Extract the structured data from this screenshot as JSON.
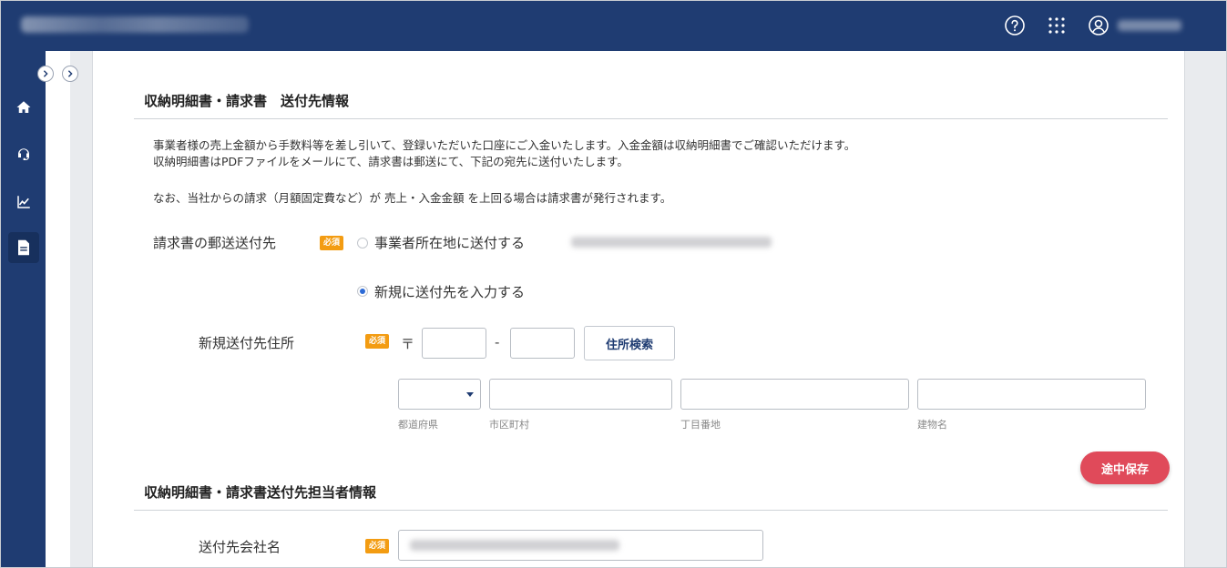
{
  "header": {
    "brand_text": "",
    "user_name": "",
    "icons": [
      "help-icon",
      "apps-grid-icon",
      "user-icon"
    ],
    "bg_color": "#1f3c72"
  },
  "sidebar": {
    "items": [
      {
        "icon": "home-icon"
      },
      {
        "icon": "support-headset-icon"
      },
      {
        "icon": "chart-icon"
      },
      {
        "icon": "document-icon",
        "active": true
      }
    ]
  },
  "section1": {
    "title": "収納明細書・請求書　送付先情報",
    "paragraph_lines": [
      "事業者様の売上金額から手数料等を差し引いて、登録いただいた口座にご入金いたします。入金金額は収納明細書でご確認いただけます。",
      "収納明細書はPDFファイルをメールにて、請求書は郵送にて、下記の宛先に送付いたします。",
      "なお、当社からの請求（月額固定費など）が 売上・入金金額 を上回る場合は請求書が発行されます。"
    ]
  },
  "mailing": {
    "label": "請求書の郵送送付先",
    "required_badge": "必須",
    "option1": "事業者所在地に送付する",
    "option2": "新規に送付先を入力する",
    "selected": "option2"
  },
  "new_address": {
    "label": "新規送付先住所",
    "required_badge": "必須",
    "postal_mark": "〒",
    "dash": "-",
    "search_button": "住所検索",
    "captions": {
      "prefecture": "都道府県",
      "city": "市区町村",
      "street": "丁目番地",
      "building": "建物名"
    }
  },
  "save_button": "途中保存",
  "section2": {
    "title": "収納明細書・請求書送付先担当者情報",
    "company_label": "送付先会社名",
    "required_badge": "必須"
  },
  "colors": {
    "accent": "#1f3c72",
    "required": "#f39c12",
    "save": "#e04a5a",
    "radio_selected": "#2d6bd6"
  }
}
